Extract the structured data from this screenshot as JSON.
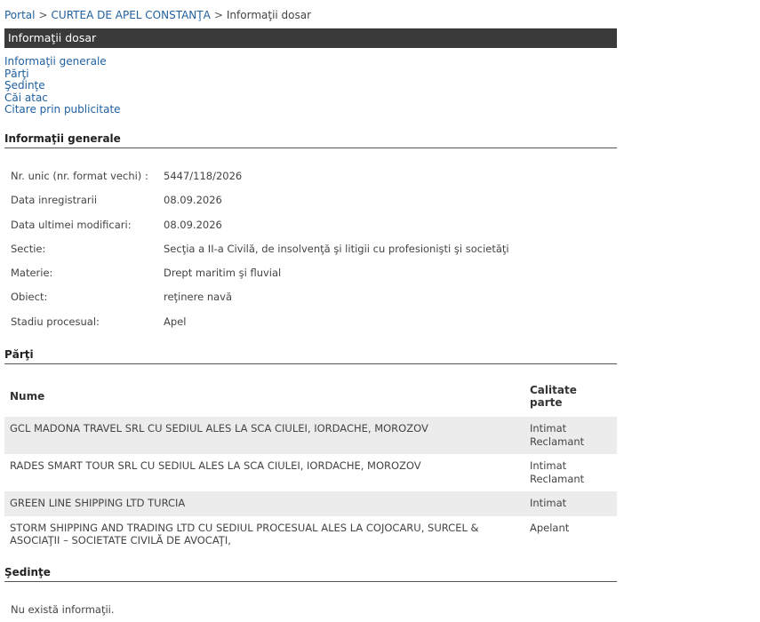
{
  "breadcrumb": {
    "portal": "Portal",
    "sep1": ">",
    "court": "CURTEA DE APEL CONSTANŢA",
    "sep2": ">",
    "current": "Informaţii dosar"
  },
  "title": "Informaţii dosar",
  "nav": [
    "Informaţii generale",
    "Părţi",
    "Şedinţe",
    "Căi atac",
    "Citare prin publicitate"
  ],
  "general": {
    "heading": "Informaţii generale",
    "rows": [
      {
        "label": "Nr. unic (nr. format vechi) :",
        "value": "5447/118/2026"
      },
      {
        "label": "Data inregistrarii",
        "value": "08.09.2026"
      },
      {
        "label": "Data ultimei modificari:",
        "value": "08.09.2026"
      },
      {
        "label": "Sectie:",
        "value": "Secţia a II-a Civilă, de insolvenţă şi litigii cu profesionişti şi societăţi"
      },
      {
        "label": "Materie:",
        "value": "Drept maritim şi fluvial"
      },
      {
        "label": "Obiect:",
        "value": "reţinere navă"
      },
      {
        "label": "Stadiu procesual:",
        "value": "Apel"
      }
    ]
  },
  "parti": {
    "heading": "Părţi",
    "col_name": "Nume",
    "col_role": "Calitate parte",
    "rows": [
      {
        "name": "GCL MADONA TRAVEL SRL CU SEDIUL ALES LA SCA CIULEI, IORDACHE, MOROZOV",
        "role1": "Intimat",
        "role2": "Reclamant"
      },
      {
        "name": "RADES SMART TOUR SRL CU SEDIUL ALES LA SCA CIULEI, IORDACHE, MOROZOV",
        "role1": "Intimat",
        "role2": "Reclamant"
      },
      {
        "name": "GREEN LINE SHIPPING LTD TURCIA",
        "role1": "Intimat",
        "role2": ""
      },
      {
        "name": "STORM SHIPPING AND TRADING LTD CU SEDIUL PROCESUAL ALES LA COJOCARU, SURCEL & ASOCIAŢII – SOCIETATE CIVILĂ DE AVOCAŢI,",
        "role1": "Apelant",
        "role2": ""
      }
    ]
  },
  "sedinte": {
    "heading": "Şedinţe",
    "empty": "Nu există informaţii."
  }
}
